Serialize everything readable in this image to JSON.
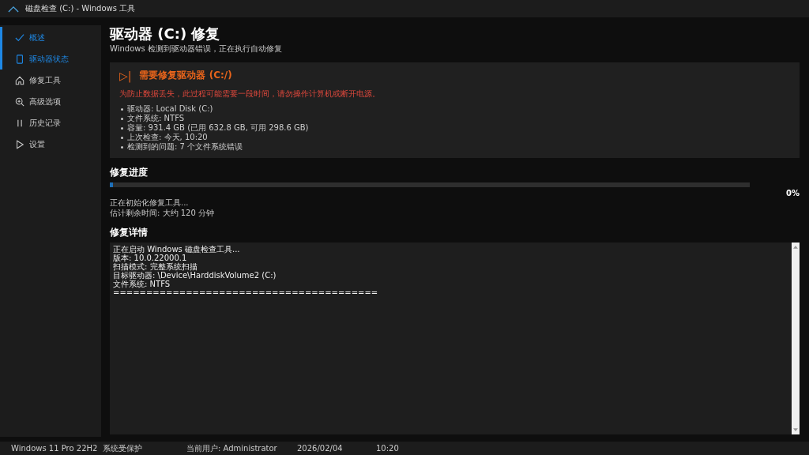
{
  "window": {
    "title": "磁盘检查 (C:) - Windows 工具"
  },
  "sidebar": {
    "items": [
      {
        "label": "概述",
        "selected": true
      },
      {
        "label": "驱动器状态",
        "selected": true
      },
      {
        "label": "修复工具",
        "selected": false
      },
      {
        "label": "高级选项",
        "selected": false
      },
      {
        "label": "历史记录",
        "selected": false
      },
      {
        "label": "设置",
        "selected": false
      }
    ]
  },
  "header": {
    "title": "驱动器 (C:) 修复",
    "subtitle": "Windows 检测到驱动器错误，正在执行自动修复"
  },
  "alert": {
    "icon": "▷|",
    "title": "需要修复驱动器 (C:/)",
    "warning": "为防止数据丢失，此过程可能需要一段时间，请勿操作计算机或断开电源。",
    "details": [
      "驱动器: Local Disk (C:)",
      "文件系统: NTFS",
      "容量: 931.4 GB (已用 632.8 GB, 可用 298.6 GB)",
      "上次检查: 今天, 10:20",
      "检测到的问题: 7 个文件系统错误"
    ]
  },
  "progress": {
    "heading": "修复进度",
    "level": 0.005,
    "percent": "0%",
    "status": "正在初始化修复工具...",
    "eta": "估计剩余时间: 大约 120 分钟"
  },
  "log": {
    "heading": "修复详情",
    "lines": [
      "正在启动 Windows 磁盘检查工具...",
      "版本: 10.0.22000.1",
      "扫描模式: 完整系统扫描",
      "目标驱动器: \\Device\\HarddiskVolume2 (C:)",
      "文件系统: NTFS",
      "========================================"
    ]
  },
  "status_bar": [
    "Windows 11 Pro 22H2",
    "系统受保护",
    "当前用户: Administrator",
    "2026/02/04",
    "10:20"
  ]
}
